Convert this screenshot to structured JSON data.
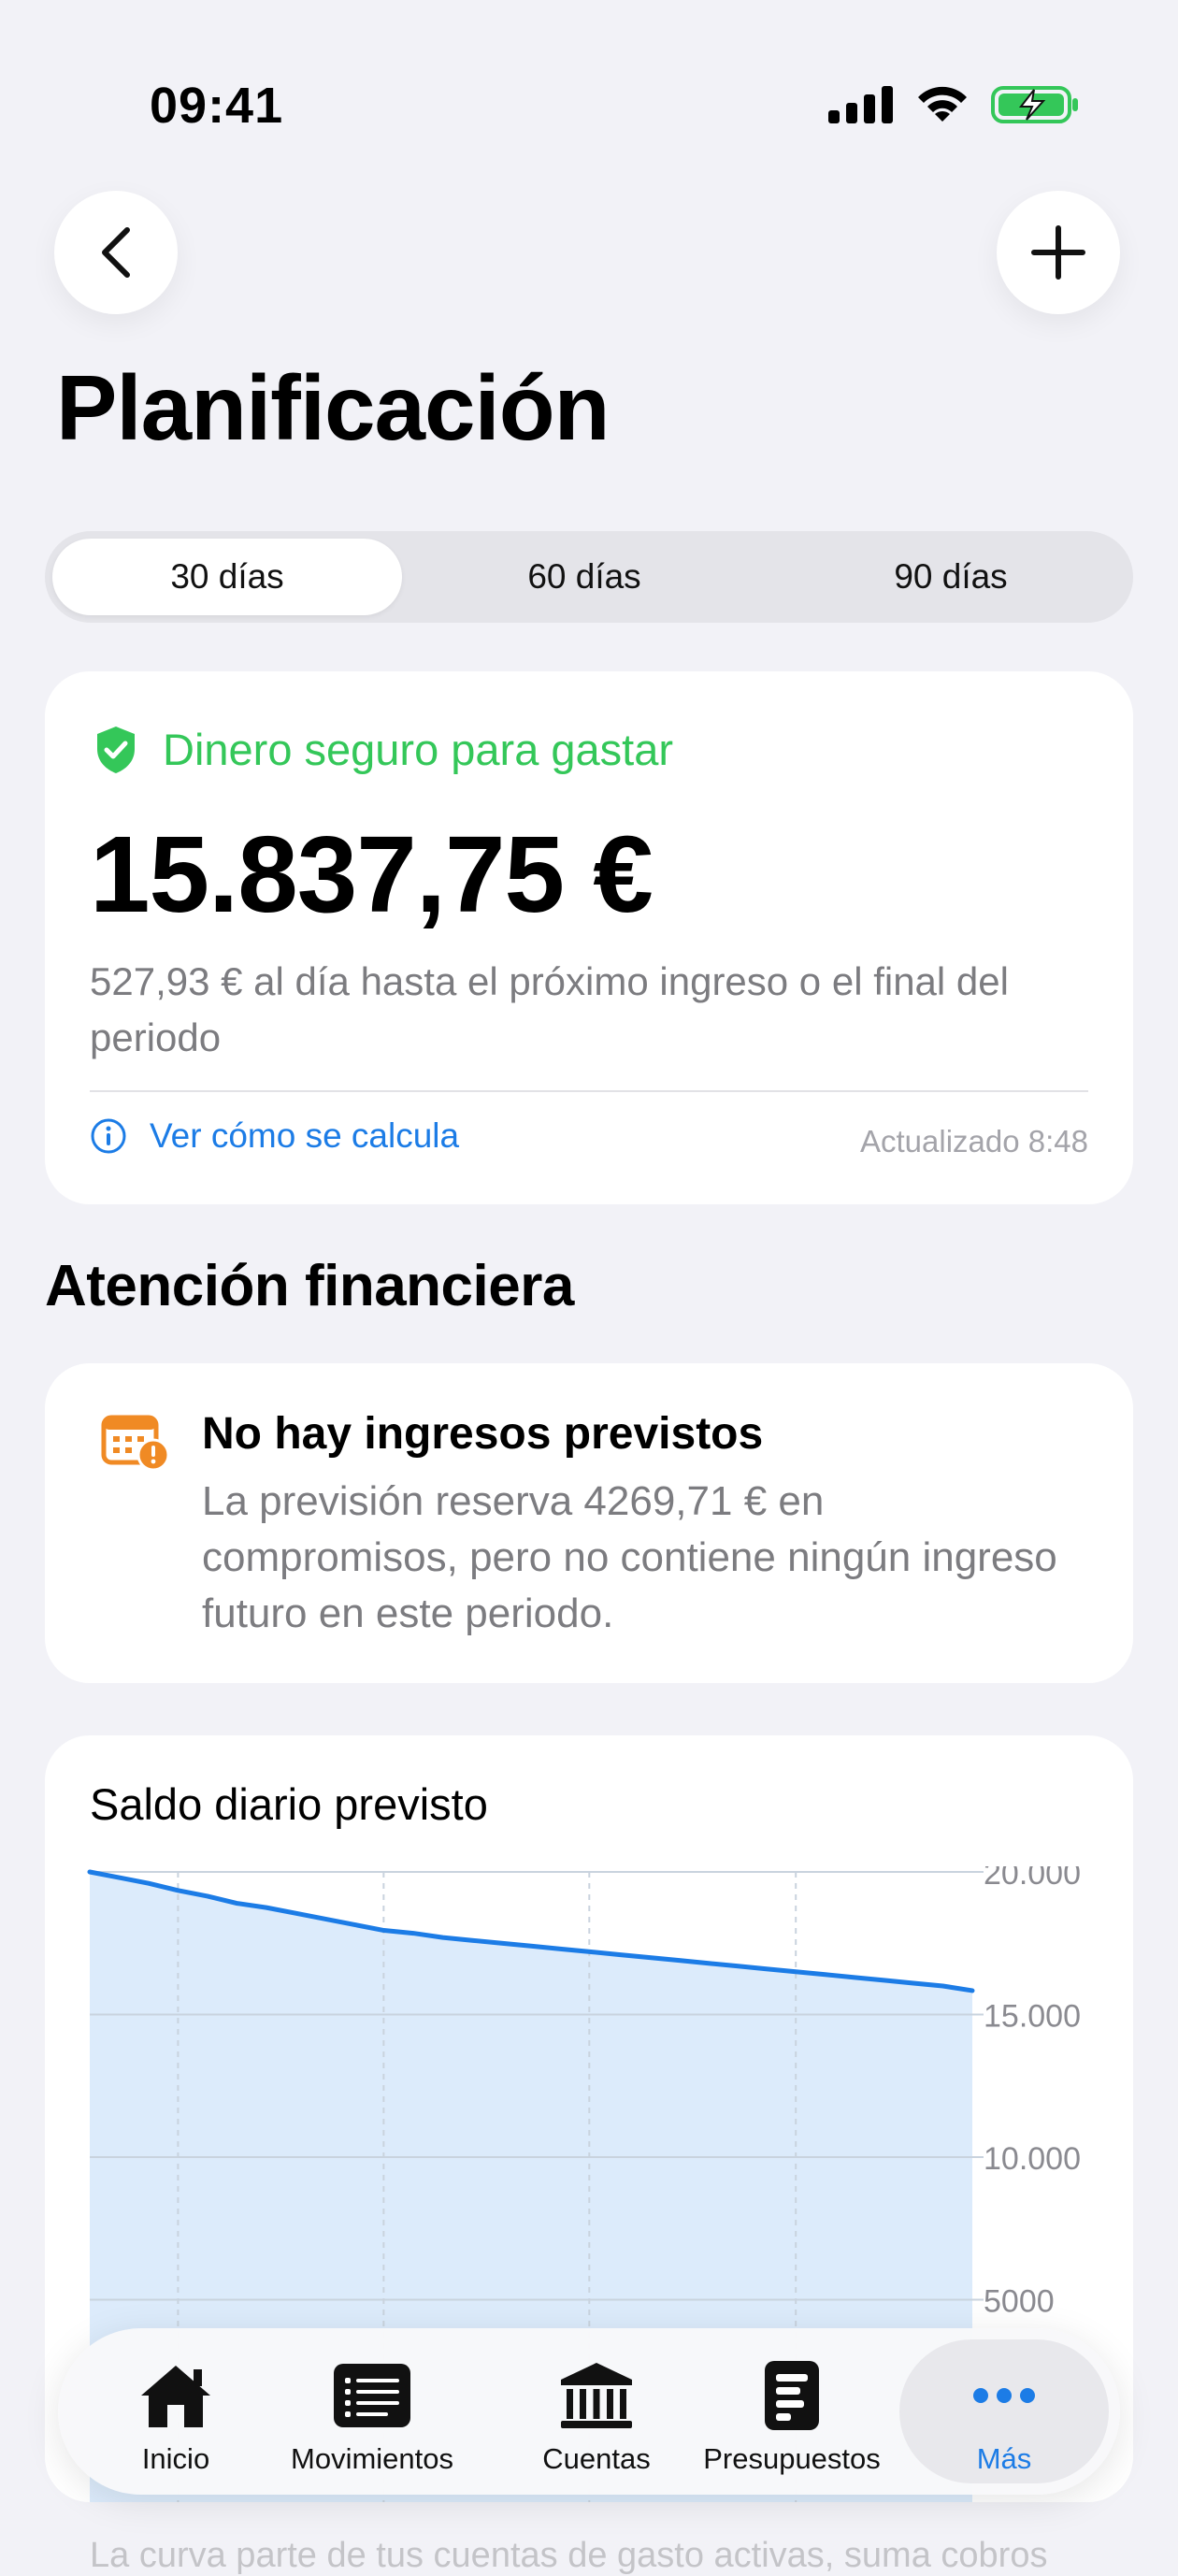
{
  "status": {
    "time": "09:41"
  },
  "header": {
    "title": "Planificación"
  },
  "tabs": {
    "items": [
      "30 días",
      "60 días",
      "90 días"
    ],
    "selected": "30 días"
  },
  "safe_card": {
    "label": "Dinero seguro para gastar",
    "amount": "15.837,75 €",
    "subtitle": "527,93 € al día hasta el próximo ingreso o el final del periodo",
    "link": "Ver cómo se calcula",
    "updated": "Actualizado 8:48"
  },
  "attention": {
    "title": "Atención financiera",
    "card_title": "No hay ingresos previstos",
    "card_text": "La previsión reserva 4269,71 € en compromisos, pero no contiene ningún ingreso futuro en este periodo."
  },
  "chart": {
    "title": "Saldo diario previsto"
  },
  "chart_data": {
    "type": "area",
    "title": "Saldo diario previsto",
    "x": [
      0,
      1,
      2,
      3,
      4,
      5,
      6,
      7,
      8,
      9,
      10,
      11,
      12,
      13,
      14,
      15,
      16,
      17,
      18,
      19,
      20,
      21,
      22,
      23,
      24,
      25,
      26,
      27,
      28,
      29,
      30
    ],
    "values": [
      20000,
      19800,
      19600,
      19350,
      19150,
      18900,
      18750,
      18550,
      18350,
      18150,
      17950,
      17850,
      17700,
      17600,
      17500,
      17400,
      17300,
      17200,
      17100,
      17000,
      16900,
      16800,
      16700,
      16600,
      16500,
      16400,
      16300,
      16200,
      16100,
      16000,
      15837.75
    ],
    "yticks": [
      "20.000",
      "15.000",
      "10.000",
      "5000"
    ],
    "ylim": [
      0,
      20000
    ],
    "color": "#1C7CE6",
    "fill": "#DCEBFB"
  },
  "footer_text": "La curva parte de tus cuentas de gasto activas, suma cobros",
  "tabbar": {
    "items": [
      {
        "label": "Inicio",
        "icon": "home-icon"
      },
      {
        "label": "Movimientos",
        "icon": "list-icon"
      },
      {
        "label": "Cuentas",
        "icon": "bank-icon"
      },
      {
        "label": "Presupuestos",
        "icon": "budget-icon"
      },
      {
        "label": "Más",
        "icon": "more-icon"
      }
    ],
    "active": "Más"
  }
}
